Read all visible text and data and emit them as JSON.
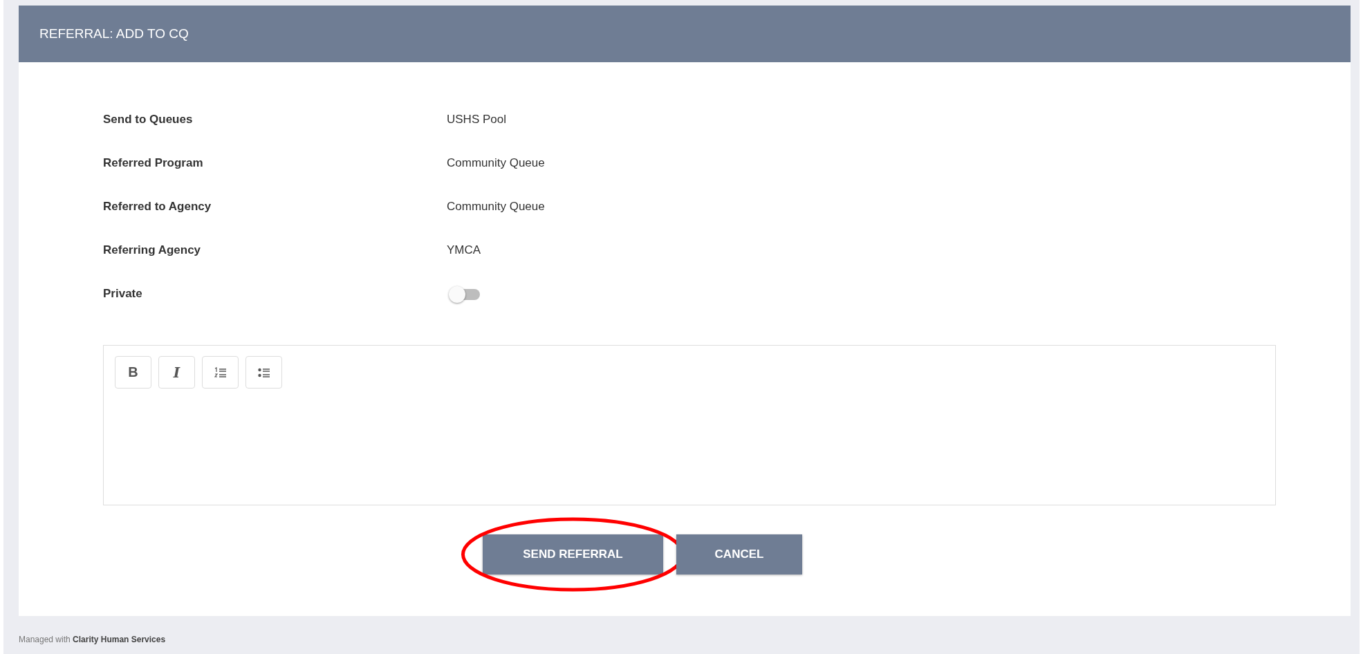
{
  "dialog": {
    "title": "REFERRAL: ADD TO CQ"
  },
  "fields": [
    {
      "label": "Send to Queues",
      "value": "USHS Pool",
      "kind": "text"
    },
    {
      "label": "Referred Program",
      "value": "Community Queue",
      "kind": "text"
    },
    {
      "label": "Referred to Agency",
      "value": "Community Queue",
      "kind": "text"
    },
    {
      "label": "Referring Agency",
      "value": "YMCA",
      "kind": "text"
    },
    {
      "label": "Private",
      "kind": "toggle",
      "on": false
    }
  ],
  "editor": {
    "toolbar": [
      {
        "kind": "bold",
        "text": "B"
      },
      {
        "kind": "italic",
        "text": "I"
      },
      {
        "kind": "ordered-list"
      },
      {
        "kind": "bullet-list"
      }
    ]
  },
  "buttons": [
    {
      "label": "SEND REFERRAL",
      "highlighted": true
    },
    {
      "label": "CANCEL",
      "highlighted": false
    }
  ],
  "footer": "Managed with **Clarity Human Services**"
}
